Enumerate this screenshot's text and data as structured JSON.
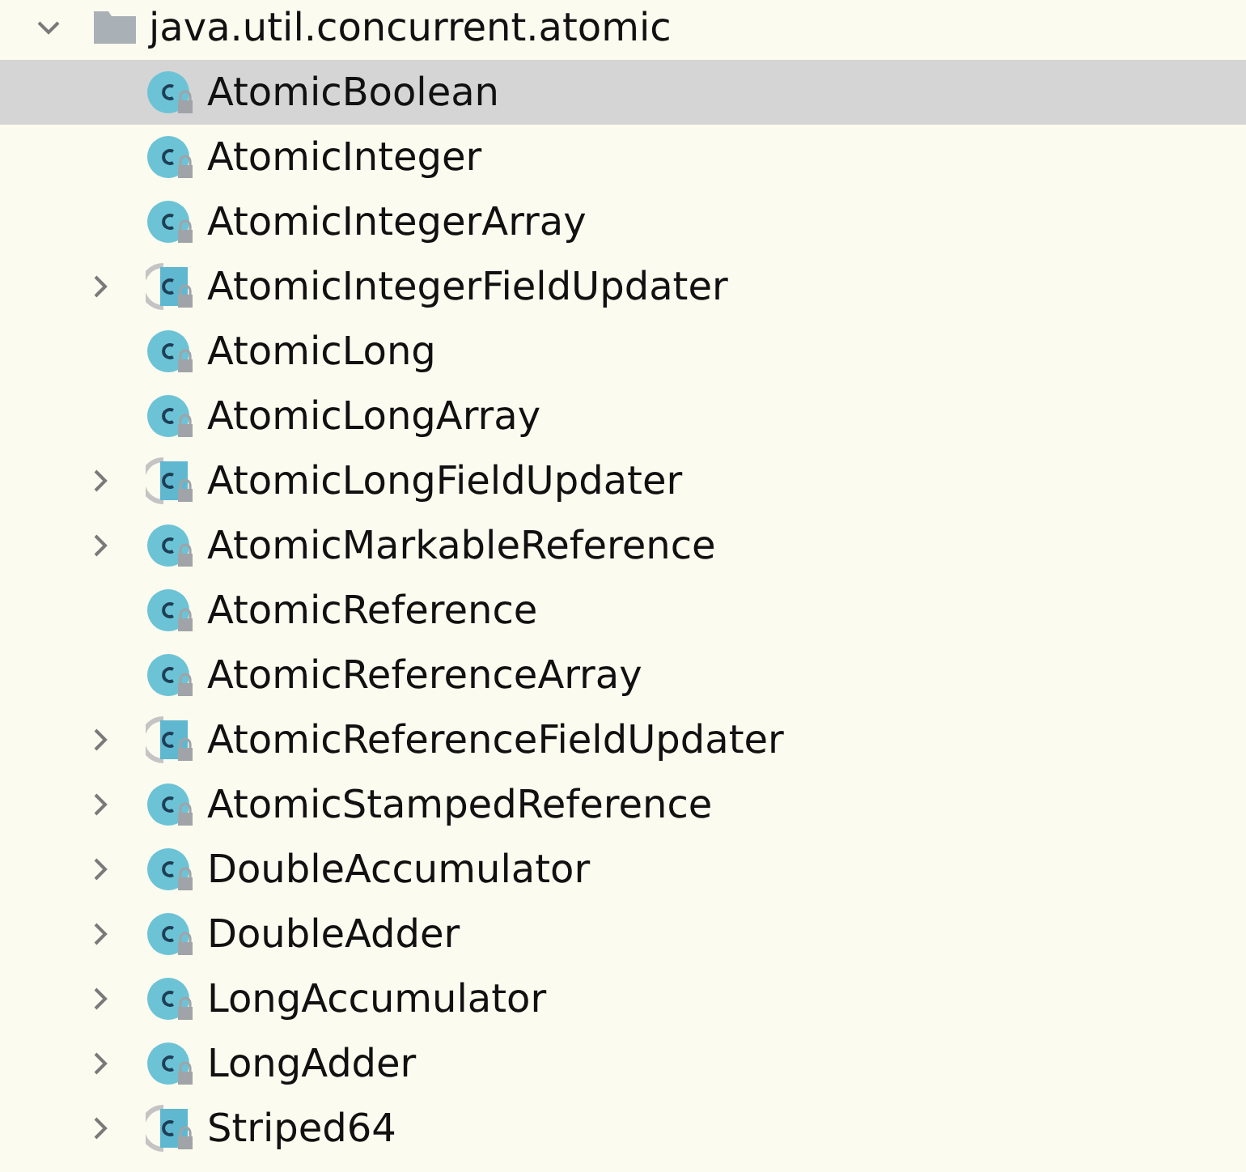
{
  "tree": {
    "label": "java.util.concurrent.atomic",
    "kind": "package",
    "expanded": true,
    "selected": false,
    "children": [
      {
        "label": "AtomicBoolean",
        "kind": "class",
        "selected": true
      },
      {
        "label": "AtomicInteger",
        "kind": "class",
        "selected": false
      },
      {
        "label": "AtomicIntegerArray",
        "kind": "class",
        "selected": false
      },
      {
        "label": "AtomicIntegerFieldUpdater",
        "kind": "abstract_class",
        "selected": false,
        "expanded": false
      },
      {
        "label": "AtomicLong",
        "kind": "class",
        "selected": false
      },
      {
        "label": "AtomicLongArray",
        "kind": "class",
        "selected": false
      },
      {
        "label": "AtomicLongFieldUpdater",
        "kind": "abstract_class",
        "selected": false,
        "expanded": false
      },
      {
        "label": "AtomicMarkableReference",
        "kind": "class",
        "selected": false,
        "expanded": false
      },
      {
        "label": "AtomicReference",
        "kind": "class",
        "selected": false
      },
      {
        "label": "AtomicReferenceArray",
        "kind": "class",
        "selected": false
      },
      {
        "label": "AtomicReferenceFieldUpdater",
        "kind": "abstract_class",
        "selected": false,
        "expanded": false
      },
      {
        "label": "AtomicStampedReference",
        "kind": "class",
        "selected": false,
        "expanded": false
      },
      {
        "label": "DoubleAccumulator",
        "kind": "class",
        "selected": false,
        "expanded": false
      },
      {
        "label": "DoubleAdder",
        "kind": "class",
        "selected": false,
        "expanded": false
      },
      {
        "label": "LongAccumulator",
        "kind": "class",
        "selected": false,
        "expanded": false
      },
      {
        "label": "LongAdder",
        "kind": "class",
        "selected": false,
        "expanded": false
      },
      {
        "label": "Striped64",
        "kind": "abstract_class",
        "selected": false,
        "expanded": false
      }
    ]
  }
}
